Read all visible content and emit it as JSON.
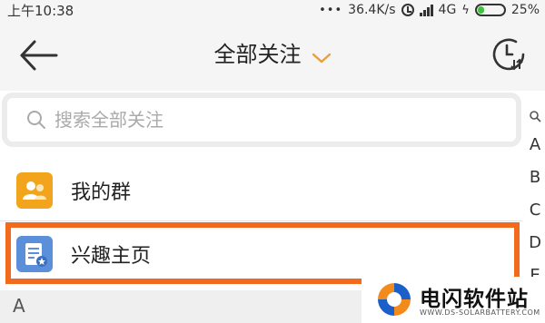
{
  "status_bar": {
    "time": "上午10:38",
    "speed": "36.4K/s",
    "network": "4G",
    "battery": "25%",
    "battery_level": 0.25,
    "battery_color": "#3cc43c"
  },
  "header": {
    "title": "全部关注",
    "back_icon": "arrow-left-icon",
    "dropdown_icon": "chevron-down-icon",
    "history_icon": "history-clock-icon"
  },
  "search": {
    "placeholder": "搜索全部关注"
  },
  "index_bar": {
    "items": [
      "A",
      "B",
      "C",
      "D",
      "E"
    ]
  },
  "list": {
    "items": [
      {
        "label": "我的群",
        "icon": "group-icon",
        "icon_color": "#f2a51c"
      },
      {
        "label": "兴趣主页",
        "icon": "interest-page-icon",
        "icon_color": "#5b8fd9"
      }
    ]
  },
  "highlight_color": "#f26a1b",
  "section": {
    "letter": "A"
  },
  "watermark": {
    "name": "电闪软件站",
    "domain": "WWW.DS-SOLARBATTERY.COM"
  }
}
